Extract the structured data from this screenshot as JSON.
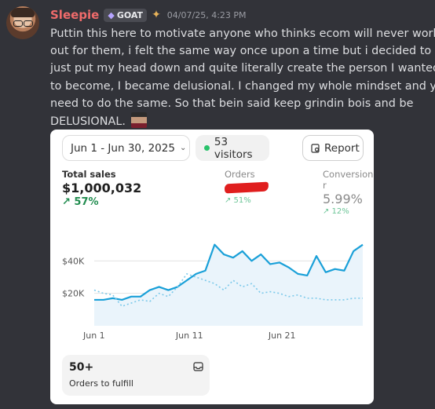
{
  "message": {
    "username": "Sleepie",
    "badge": "GOAT",
    "timestamp": "04/07/25, 4:23 PM",
    "lines": [
      "Puttin this here to motivate anyone who thinks ecom will never work",
      "out for them, i felt the same way once upon a time but i decided to",
      "just put my head down and quite literally create the person I wanted",
      "to become, I became delusional. I changed my whole mindset and you",
      "need to do the same. So that bein said keep grindin bois and be",
      "DELUSIONAL."
    ]
  },
  "dashboard": {
    "date_range": "Jun 1 - Jun 30, 2025",
    "visitors": "53 visitors",
    "report_label": "Report",
    "metrics": [
      {
        "label": "Total sales",
        "value": "$1,000,032",
        "change": "↗ 57%"
      },
      {
        "label": "Orders",
        "value": "",
        "change": "↗ 51%"
      },
      {
        "label": "Conversion r",
        "value": "5.99%",
        "change": "↗ 12%"
      }
    ],
    "fulfill": {
      "count": "50+",
      "label": "Orders to fulfill"
    }
  },
  "chart_data": {
    "type": "line",
    "yticks": [
      "$40K",
      "$20K"
    ],
    "xticks": [
      "Jun 1",
      "Jun 11",
      "Jun 21"
    ],
    "x": [
      1,
      2,
      3,
      4,
      5,
      6,
      7,
      8,
      9,
      10,
      11,
      12,
      13,
      14,
      15,
      16,
      17,
      18,
      19,
      20,
      21,
      22,
      23,
      24,
      25,
      26,
      27,
      28,
      29,
      30
    ],
    "series": [
      {
        "values": [
          16,
          16,
          17,
          16,
          18,
          18,
          22,
          24,
          22,
          24,
          28,
          32,
          34,
          50,
          44,
          42,
          46,
          40,
          44,
          38,
          39,
          36,
          32,
          31,
          43,
          33,
          35,
          34,
          46,
          50
        ]
      },
      {
        "values": [
          22,
          20,
          19,
          12,
          14,
          16,
          15,
          20,
          18,
          24,
          32,
          30,
          28,
          26,
          22,
          28,
          24,
          26,
          20,
          21,
          20,
          18,
          19,
          17,
          17,
          16,
          16,
          16,
          17,
          17
        ]
      }
    ],
    "colors": [
      "#1aa0d8",
      "#7cc9ea"
    ],
    "ylim": [
      0,
      60
    ]
  }
}
